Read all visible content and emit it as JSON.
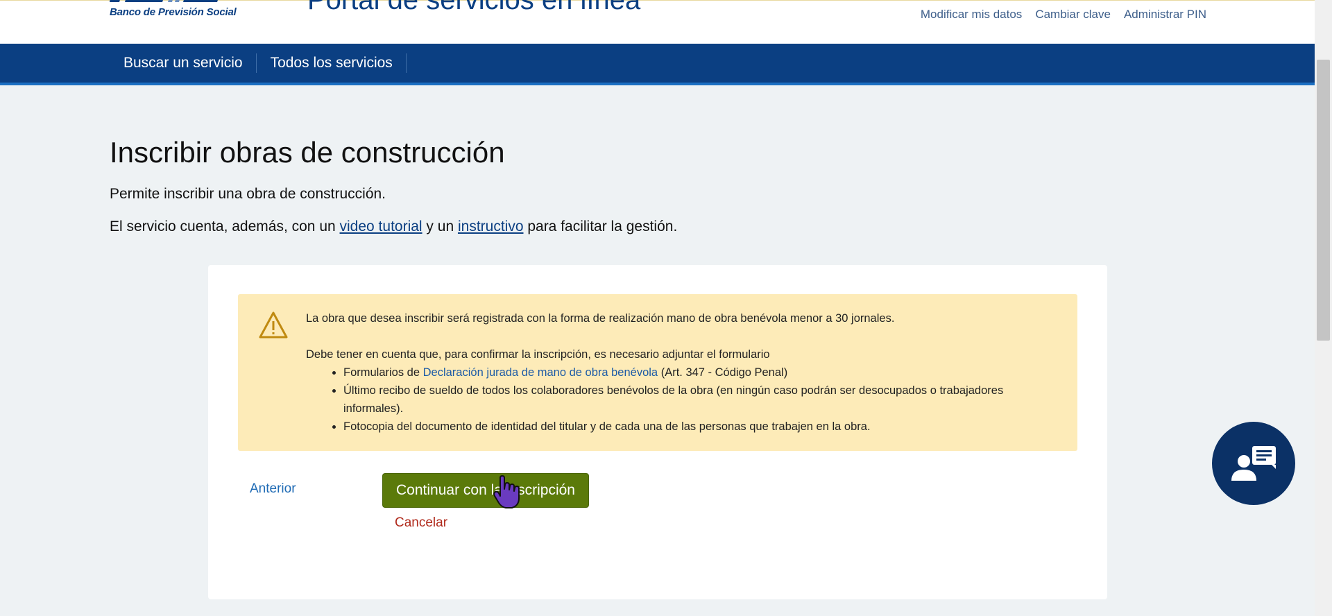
{
  "header": {
    "logo_text": "Banco de Previsión Social",
    "portal_title": "Portal de servicios en línea",
    "user_links": [
      "Modificar mis datos",
      "Cambiar clave",
      "Administrar PIN"
    ]
  },
  "nav": {
    "items": [
      "Buscar un servicio",
      "Todos los servicios"
    ]
  },
  "main": {
    "title": "Inscribir obras de construcción",
    "description": "Permite inscribir una obra de construcción.",
    "tutorial_prefix": "El servicio cuenta, además, con un ",
    "tutorial_link": "video tutorial",
    "tutorial_middle": " y un ",
    "instructivo_link": "instructivo",
    "tutorial_suffix": " para facilitar la gestión."
  },
  "warning": {
    "line1": "La obra que desea inscribir será registrada con la forma de realización mano de obra benévola menor a 30 jornales.",
    "line2": "Debe tener en cuenta que, para confirmar la inscripción, es necesario adjuntar el formulario",
    "item1_prefix": "Formularios de ",
    "item1_link": "Declaración jurada de mano de obra benévola",
    "item1_suffix": " (Art. 347 - Código Penal)",
    "item2": "Último recibo de sueldo de todos los colaboradores benévolos de la obra (en ningún caso podrán ser desocupados o trabajadores informales).",
    "item3": "Fotocopia del documento de identidad del titular y de cada una de las personas que trabajen en la obra."
  },
  "actions": {
    "previous": "Anterior",
    "continue": "Continuar con la inscripción",
    "cancel": "Cancelar"
  },
  "colors": {
    "brand_blue": "#0b3f82",
    "continue_green": "#5b7a0a",
    "warning_bg": "#fdebb8",
    "cancel_red": "#b02a1c"
  },
  "icons": [
    "bps-logo",
    "warning-icon",
    "chat-support-icon",
    "hand-cursor-icon"
  ]
}
